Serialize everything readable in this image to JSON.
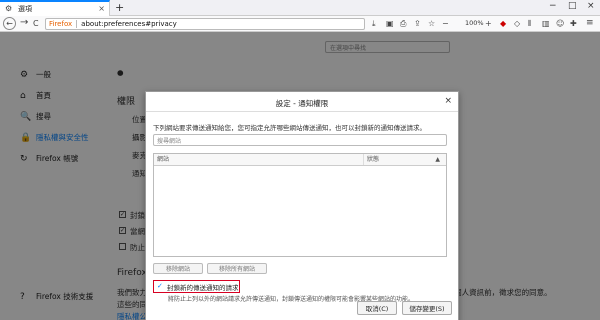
{
  "tab": {
    "title": "選項",
    "close": "×"
  },
  "newtab": "+",
  "window": {
    "minimize": "−",
    "maximize": "□",
    "close": "×"
  },
  "nav": {
    "back": "←",
    "forward": "→",
    "reload": "C"
  },
  "urlbar": {
    "brand": "Firefox",
    "url": "about:preferences#privacy"
  },
  "toolbar": {
    "zoom": "100%",
    "menu": "≡"
  },
  "page": {
    "search_placeholder": "在選項中尋找",
    "categories": [
      {
        "icon": "⚙",
        "label": "一般"
      },
      {
        "icon": "⌂",
        "label": "首頁"
      },
      {
        "icon": "🔍",
        "label": "搜尋"
      },
      {
        "icon": "🔒",
        "label": "隱私權與安全性"
      },
      {
        "icon": "↻",
        "label": "Firefox 帳號"
      }
    ],
    "support": "Firefox 技術支援",
    "permissions_heading": "權限",
    "firefox_heading": "Firefox",
    "privacy_link": "隱私權公告",
    "perm_items": [
      "位置",
      "攝影",
      "麥克",
      "通知"
    ],
    "checks": [
      "封鎖",
      "當網",
      "防止"
    ],
    "footer_text": "我們致力於讓您有選擇，只收集我們需要來提供服務與改善 Firefox 的資料。我們也一定會在收集您的個人資訊前，徵求您的同意。",
    "footer_line2": "這些的同意才收集您的個人資訊。"
  },
  "dialog": {
    "title": "設定 - 通知權限",
    "close": "×",
    "description": "下列網站要求傳送通知給您，您可指定允許哪些網站傳送通知，也可以封鎖新的通知傳送請求。",
    "search_placeholder": "搜尋網站",
    "columns": {
      "site": "網站",
      "status": "狀態"
    },
    "remove_site": "移除網站",
    "remove_all": "移除所有網站",
    "block_label": "封鎖新的傳送通知的請求",
    "block_note": "將防止上列以外的網站請求允許傳送通知，封鎖傳送通知的權限可能會影響某些網站的功能。",
    "cancel": "取消(C)",
    "save": "儲存變更(S)"
  }
}
